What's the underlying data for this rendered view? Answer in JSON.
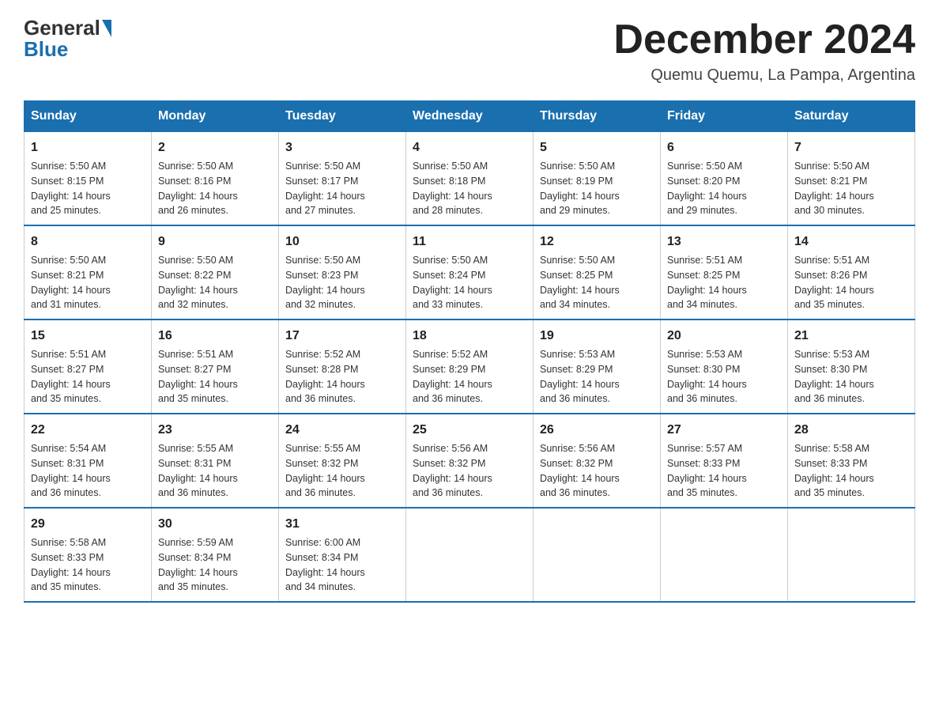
{
  "header": {
    "logo_general": "General",
    "logo_blue": "Blue",
    "title": "December 2024",
    "location": "Quemu Quemu, La Pampa, Argentina"
  },
  "days_of_week": [
    "Sunday",
    "Monday",
    "Tuesday",
    "Wednesday",
    "Thursday",
    "Friday",
    "Saturday"
  ],
  "weeks": [
    [
      {
        "day": "1",
        "info": "Sunrise: 5:50 AM\nSunset: 8:15 PM\nDaylight: 14 hours\nand 25 minutes."
      },
      {
        "day": "2",
        "info": "Sunrise: 5:50 AM\nSunset: 8:16 PM\nDaylight: 14 hours\nand 26 minutes."
      },
      {
        "day": "3",
        "info": "Sunrise: 5:50 AM\nSunset: 8:17 PM\nDaylight: 14 hours\nand 27 minutes."
      },
      {
        "day": "4",
        "info": "Sunrise: 5:50 AM\nSunset: 8:18 PM\nDaylight: 14 hours\nand 28 minutes."
      },
      {
        "day": "5",
        "info": "Sunrise: 5:50 AM\nSunset: 8:19 PM\nDaylight: 14 hours\nand 29 minutes."
      },
      {
        "day": "6",
        "info": "Sunrise: 5:50 AM\nSunset: 8:20 PM\nDaylight: 14 hours\nand 29 minutes."
      },
      {
        "day": "7",
        "info": "Sunrise: 5:50 AM\nSunset: 8:21 PM\nDaylight: 14 hours\nand 30 minutes."
      }
    ],
    [
      {
        "day": "8",
        "info": "Sunrise: 5:50 AM\nSunset: 8:21 PM\nDaylight: 14 hours\nand 31 minutes."
      },
      {
        "day": "9",
        "info": "Sunrise: 5:50 AM\nSunset: 8:22 PM\nDaylight: 14 hours\nand 32 minutes."
      },
      {
        "day": "10",
        "info": "Sunrise: 5:50 AM\nSunset: 8:23 PM\nDaylight: 14 hours\nand 32 minutes."
      },
      {
        "day": "11",
        "info": "Sunrise: 5:50 AM\nSunset: 8:24 PM\nDaylight: 14 hours\nand 33 minutes."
      },
      {
        "day": "12",
        "info": "Sunrise: 5:50 AM\nSunset: 8:25 PM\nDaylight: 14 hours\nand 34 minutes."
      },
      {
        "day": "13",
        "info": "Sunrise: 5:51 AM\nSunset: 8:25 PM\nDaylight: 14 hours\nand 34 minutes."
      },
      {
        "day": "14",
        "info": "Sunrise: 5:51 AM\nSunset: 8:26 PM\nDaylight: 14 hours\nand 35 minutes."
      }
    ],
    [
      {
        "day": "15",
        "info": "Sunrise: 5:51 AM\nSunset: 8:27 PM\nDaylight: 14 hours\nand 35 minutes."
      },
      {
        "day": "16",
        "info": "Sunrise: 5:51 AM\nSunset: 8:27 PM\nDaylight: 14 hours\nand 35 minutes."
      },
      {
        "day": "17",
        "info": "Sunrise: 5:52 AM\nSunset: 8:28 PM\nDaylight: 14 hours\nand 36 minutes."
      },
      {
        "day": "18",
        "info": "Sunrise: 5:52 AM\nSunset: 8:29 PM\nDaylight: 14 hours\nand 36 minutes."
      },
      {
        "day": "19",
        "info": "Sunrise: 5:53 AM\nSunset: 8:29 PM\nDaylight: 14 hours\nand 36 minutes."
      },
      {
        "day": "20",
        "info": "Sunrise: 5:53 AM\nSunset: 8:30 PM\nDaylight: 14 hours\nand 36 minutes."
      },
      {
        "day": "21",
        "info": "Sunrise: 5:53 AM\nSunset: 8:30 PM\nDaylight: 14 hours\nand 36 minutes."
      }
    ],
    [
      {
        "day": "22",
        "info": "Sunrise: 5:54 AM\nSunset: 8:31 PM\nDaylight: 14 hours\nand 36 minutes."
      },
      {
        "day": "23",
        "info": "Sunrise: 5:55 AM\nSunset: 8:31 PM\nDaylight: 14 hours\nand 36 minutes."
      },
      {
        "day": "24",
        "info": "Sunrise: 5:55 AM\nSunset: 8:32 PM\nDaylight: 14 hours\nand 36 minutes."
      },
      {
        "day": "25",
        "info": "Sunrise: 5:56 AM\nSunset: 8:32 PM\nDaylight: 14 hours\nand 36 minutes."
      },
      {
        "day": "26",
        "info": "Sunrise: 5:56 AM\nSunset: 8:32 PM\nDaylight: 14 hours\nand 36 minutes."
      },
      {
        "day": "27",
        "info": "Sunrise: 5:57 AM\nSunset: 8:33 PM\nDaylight: 14 hours\nand 35 minutes."
      },
      {
        "day": "28",
        "info": "Sunrise: 5:58 AM\nSunset: 8:33 PM\nDaylight: 14 hours\nand 35 minutes."
      }
    ],
    [
      {
        "day": "29",
        "info": "Sunrise: 5:58 AM\nSunset: 8:33 PM\nDaylight: 14 hours\nand 35 minutes."
      },
      {
        "day": "30",
        "info": "Sunrise: 5:59 AM\nSunset: 8:34 PM\nDaylight: 14 hours\nand 35 minutes."
      },
      {
        "day": "31",
        "info": "Sunrise: 6:00 AM\nSunset: 8:34 PM\nDaylight: 14 hours\nand 34 minutes."
      },
      {
        "day": "",
        "info": ""
      },
      {
        "day": "",
        "info": ""
      },
      {
        "day": "",
        "info": ""
      },
      {
        "day": "",
        "info": ""
      }
    ]
  ]
}
